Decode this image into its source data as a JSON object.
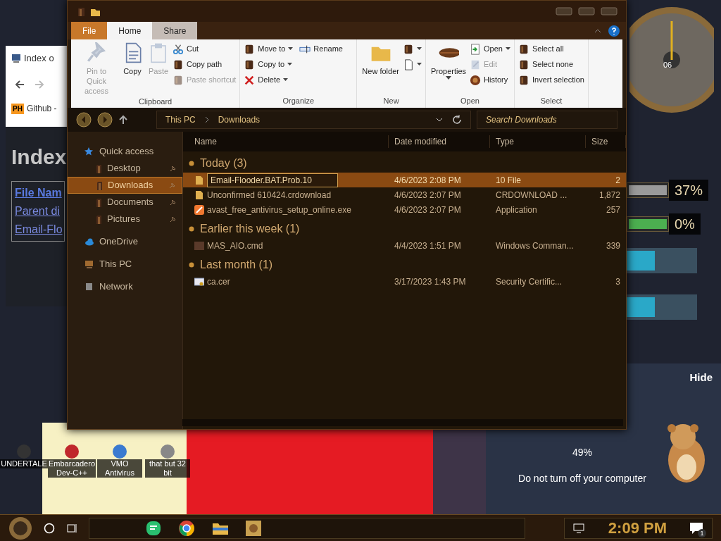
{
  "browser": {
    "tab_title": "Index o",
    "bookmark": "Github -",
    "bookmark_badge": "PH",
    "heading": "Index",
    "links": [
      "File Nam",
      "Parent di",
      "Email-Flo"
    ]
  },
  "explorer": {
    "ribbon_tabs": [
      {
        "label": "File",
        "selected": false,
        "kind": "file"
      },
      {
        "label": "Home",
        "selected": true,
        "kind": "tab"
      },
      {
        "label": "Share",
        "selected": false,
        "kind": "tab"
      }
    ],
    "ribbon_groups": [
      {
        "name": "Clipboard",
        "buttons": [
          {
            "label": "Pin to Quick access",
            "kind": "large",
            "disabled": true
          },
          {
            "label": "Copy",
            "kind": "large",
            "disabled": false
          },
          {
            "label": "Paste",
            "kind": "large",
            "disabled": true
          },
          {
            "label": "Cut",
            "kind": "small",
            "disabled": false
          },
          {
            "label": "Copy path",
            "kind": "small",
            "disabled": false
          },
          {
            "label": "Paste shortcut",
            "kind": "small",
            "disabled": true
          }
        ]
      },
      {
        "name": "Organize",
        "buttons": [
          {
            "label": "Move to",
            "kind": "small",
            "dropdown": true
          },
          {
            "label": "Copy to",
            "kind": "small",
            "dropdown": true
          },
          {
            "label": "Delete",
            "kind": "small",
            "dropdown": true
          },
          {
            "label": "Rename",
            "kind": "small"
          }
        ]
      },
      {
        "name": "New",
        "buttons": [
          {
            "label": "New folder",
            "kind": "large"
          },
          {
            "kind": "icon",
            "dropdown": true
          },
          {
            "kind": "icon",
            "dropdown": true
          }
        ]
      },
      {
        "name": "Open",
        "buttons": [
          {
            "label": "Properties",
            "kind": "large",
            "dropdown": true
          },
          {
            "label": "Open",
            "kind": "small",
            "dropdown": true
          },
          {
            "label": "Edit",
            "kind": "small",
            "disabled": true
          },
          {
            "label": "History",
            "kind": "small"
          }
        ]
      },
      {
        "name": "Select",
        "buttons": [
          {
            "label": "Select all",
            "kind": "small"
          },
          {
            "label": "Select none",
            "kind": "small"
          },
          {
            "label": "Invert selection",
            "kind": "small"
          }
        ]
      }
    ],
    "path": [
      "This PC",
      "Downloads"
    ],
    "search": {
      "placeholder": "Search Downloads"
    },
    "nav": [
      {
        "label": "Quick access",
        "kind": "star",
        "children": [
          {
            "label": "Desktop",
            "selected": false,
            "pinned": true
          },
          {
            "label": "Downloads",
            "selected": true,
            "pinned": true
          },
          {
            "label": "Documents",
            "selected": false,
            "pinned": true
          },
          {
            "label": "Pictures",
            "selected": false,
            "pinned": true
          }
        ]
      },
      {
        "label": "OneDrive",
        "kind": "cloud"
      },
      {
        "label": "This PC",
        "kind": "pc"
      },
      {
        "label": "Network",
        "kind": "network"
      }
    ],
    "columns": [
      "Name",
      "Date modified",
      "Type",
      "Size"
    ],
    "groups": [
      {
        "title": "Today (3)",
        "rows": [
          {
            "name": "Email-Flooder.BAT.Prob.10",
            "date": "4/6/2023 2:08 PM",
            "type": "10 File",
            "size": "2",
            "selected": true,
            "renaming": true,
            "kind": "file"
          },
          {
            "name": "Unconfirmed 610424.crdownload",
            "date": "4/6/2023 2:07 PM",
            "type": "CRDOWNLOAD ...",
            "size": "1,872",
            "selected": false,
            "renaming": false,
            "kind": "file"
          },
          {
            "name": "avast_free_antivirus_setup_online.exe",
            "date": "4/6/2023 2:07 PM",
            "type": "Application",
            "size": "257",
            "selected": false,
            "renaming": false,
            "kind": "app"
          }
        ]
      },
      {
        "title": "Earlier this week (1)",
        "rows": [
          {
            "name": "MAS_AIO.cmd",
            "date": "4/4/2023 1:51 PM",
            "type": "Windows Comman...",
            "size": "339",
            "selected": false,
            "renaming": false,
            "kind": "cmd"
          }
        ]
      },
      {
        "title": "Last month (1)",
        "rows": [
          {
            "name": "ca.cer",
            "date": "3/17/2023 1:43 PM",
            "type": "Security Certific...",
            "size": "3",
            "selected": false,
            "renaming": false,
            "kind": "cert"
          }
        ]
      }
    ]
  },
  "meters": [
    {
      "reading": "37%",
      "color": "#9a9a9a"
    },
    {
      "reading": "0%",
      "color": "#4caf50"
    }
  ],
  "update": {
    "hide": "Hide",
    "percent": "49%",
    "message": "Do not turn off your computer"
  },
  "desktop_icons": [
    {
      "label": "UNDERTALE"
    },
    {
      "label": "Embarcadero Dev-C++"
    },
    {
      "label": "VMO Antivirus"
    },
    {
      "label": "that but 32 bit"
    }
  ],
  "clock_face": "06",
  "taskbar": {
    "time": "2:09 PM",
    "notifications": "1"
  }
}
